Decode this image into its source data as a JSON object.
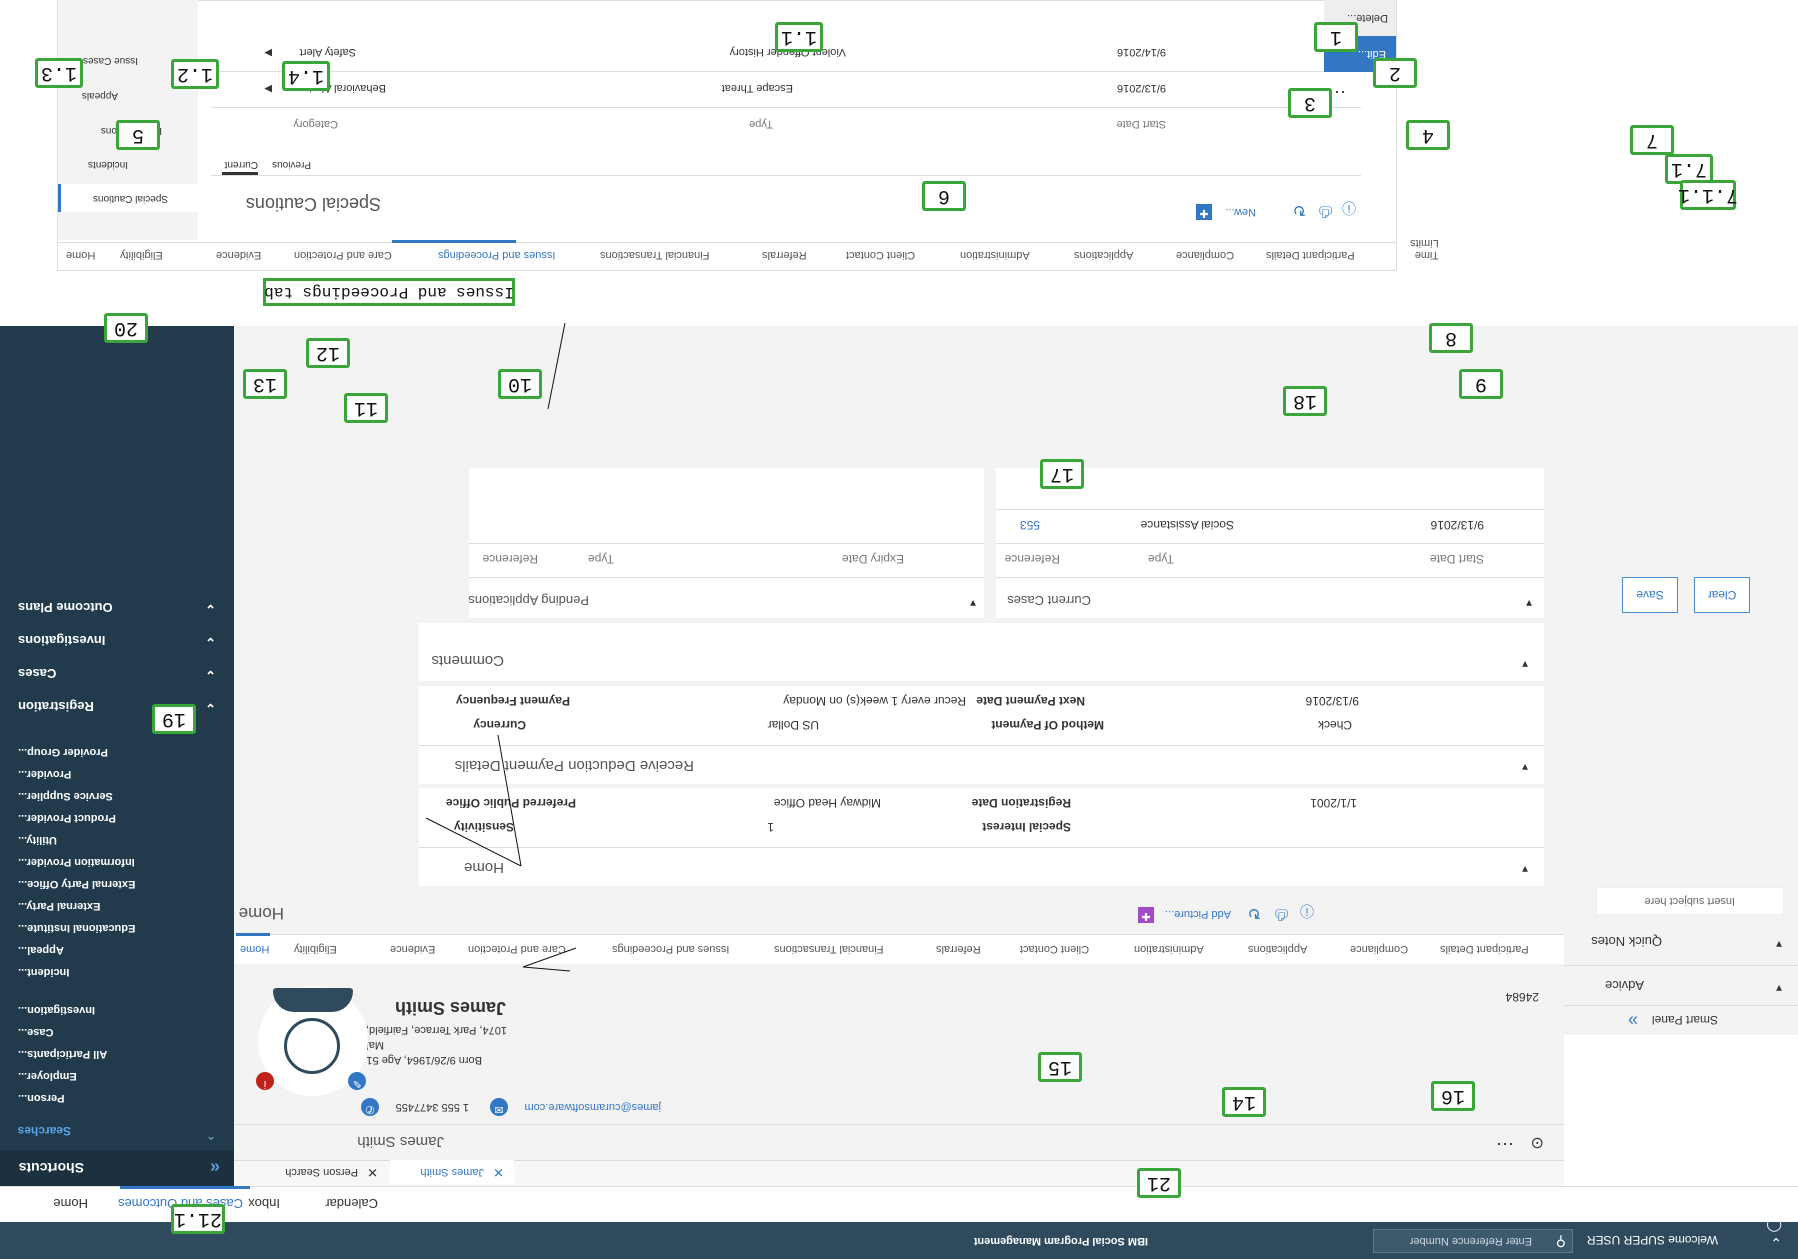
{
  "header": {
    "app_title": "IBM Social Program Management",
    "reference_placeholder": "Enter Reference Number",
    "welcome": "Welcome SUPER USER"
  },
  "app_tabs": [
    "Home",
    "Cases and Outcomes",
    "Inbox",
    "Calendar"
  ],
  "session_tabs": [
    {
      "label": "Person Search"
    },
    {
      "label": "James Smith"
    }
  ],
  "shortcuts": {
    "title": "Shortcuts",
    "searches": {
      "title": "Searches",
      "items": [
        "Person...",
        "Employer...",
        "All Participants...",
        "Case...",
        "Investigation...",
        "Incident...",
        "Appeal...",
        "Educational Institute...",
        "External Party...",
        "External Party Office...",
        "Information Provider...",
        "Utility...",
        "Product Provider...",
        "Service Supplier...",
        "Provider...",
        "Provider Group..."
      ]
    },
    "sections": [
      "Registration",
      "Cases",
      "Investigations",
      "Outcome Plans"
    ]
  },
  "person": {
    "tab_title": "James Smith",
    "name": "James Smith",
    "address": "1074, Park Terrace, Fairfield, Midway, Utah, 12345",
    "gender": "Male",
    "born": "Born 9/26/1964, Age 51",
    "phone": "1 555 3477455",
    "email": "james@curamsoftware.com",
    "id": "24684"
  },
  "nav_tabs": [
    "Home",
    "Eligibility",
    "Evidence",
    "Care and Protection",
    "Issues and Proceedings",
    "Financial Transactions",
    "Referrals",
    "Client Contact",
    "Administration",
    "Applications",
    "Compliance",
    "Participant Details",
    "Time Limits"
  ],
  "home": {
    "title": "Home",
    "add_picture": "Add Picture...",
    "section_home": "Home",
    "sensitivity_label": "Sensitivity",
    "sensitivity_value": "1",
    "pref_office_label": "Preferred Public Office",
    "pref_office_value": "Midway Head Office",
    "special_interest_label": "Special Interest",
    "reg_date_label": "Registration Date",
    "reg_date_value": "1/1/2001",
    "deduction_title": "Receive Deduction Payment Details",
    "currency_label": "Currency",
    "currency_value": "US Dollar",
    "freq_label": "Payment Frequency",
    "freq_value": "Recur every 1 week(s) on Monday",
    "method_label": "Method Of Payment",
    "method_value": "Check",
    "next_label": "Next Payment Date",
    "next_value": "9/13/2016",
    "comments_title": "Comments",
    "pending_title": "Pending Applications",
    "pending_cols": [
      "Reference",
      "Type",
      "Expiry Date"
    ],
    "current_title": "Current Cases",
    "current_cols": [
      "Reference",
      "Type",
      "Start Date"
    ],
    "current_row": [
      "553",
      "Social Assistance",
      "9/13/2016"
    ]
  },
  "smart_panel": {
    "title": "Smart Panel",
    "advice": "Advice",
    "quick_notes": "Quick Notes",
    "subject_placeholder": "Insert subject here",
    "save": "Save",
    "clear": "Clear"
  },
  "caution_inset": {
    "nav_tabs": [
      "Home",
      "Eligibility",
      "Evidence",
      "Care and Protection",
      "Issues and Proceedings",
      "Financial Transactions",
      "Referrals",
      "Client Contact",
      "Administration",
      "Applications",
      "Compliance",
      "Participant Details",
      "Time Limits"
    ],
    "side_items": [
      "Special Cautions",
      "Incidents",
      "Investigations",
      "Appeals",
      "Issue Cases"
    ],
    "title": "Special Cautions",
    "new_label": "New...",
    "sub_tabs": [
      "Current",
      "Previous"
    ],
    "cols": [
      "Category",
      "Type",
      "Start Date"
    ],
    "rows": [
      [
        "Behavioral Alert",
        "Escape Threat",
        "9/13/2016"
      ],
      [
        "Safety Alert",
        "Violent Offender History",
        "9/14/2016"
      ]
    ],
    "menu": [
      "Edit...",
      "Delete..."
    ]
  },
  "annotation_label": "Issues and Proceedings tab",
  "callouts": [
    "1",
    "1.1",
    "1.2",
    "1.3",
    "1.4",
    "2",
    "3",
    "4",
    "5",
    "6",
    "7",
    "7.1",
    "7.1.1",
    "8",
    "9",
    "10",
    "11",
    "12",
    "13",
    "14",
    "15",
    "16",
    "17",
    "18",
    "19",
    "20",
    "21",
    "21.1"
  ],
  "colors": {
    "header": "#2e4a5c",
    "sidebar": "#213b4c",
    "accent": "#3277c4",
    "callout": "#3aa63a"
  }
}
